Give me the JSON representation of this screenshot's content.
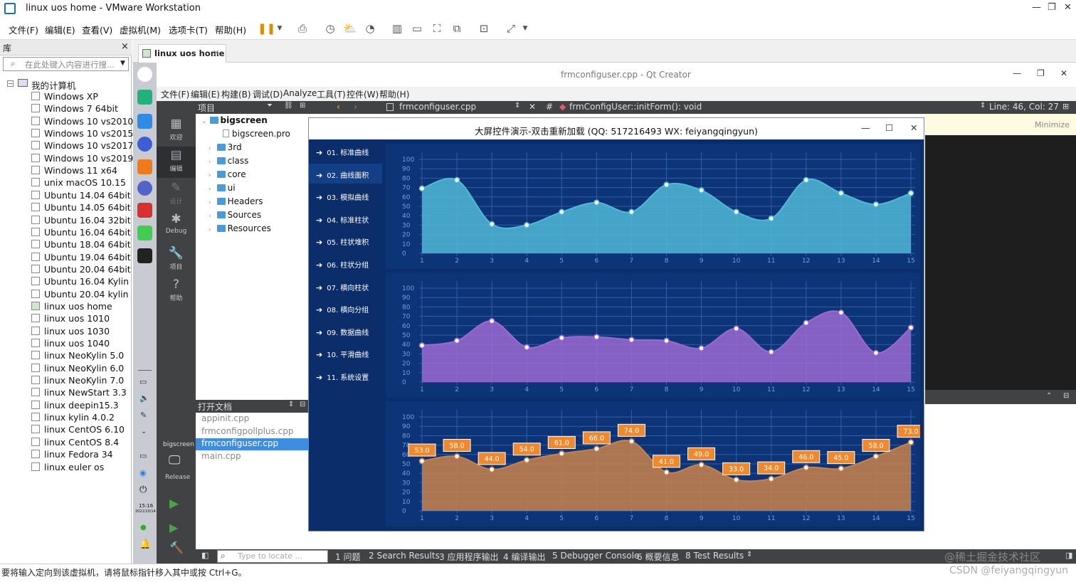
{
  "vmware": {
    "title": "linux uos home - VMware Workstation",
    "menu": [
      "文件(F)",
      "编辑(E)",
      "查看(V)",
      "虚拟机(M)",
      "选项卡(T)",
      "帮助(H)"
    ],
    "library_label": "库",
    "library_close": "×",
    "search_placeholder": "在此处键入内容进行搜...",
    "tree_root": "我的计算机",
    "vms": [
      "Windows XP",
      "Windows 7 64bit",
      "Windows 10 vs2010",
      "Windows 10 vs2015",
      "Windows 10 vs2017",
      "Windows 10 vs2019",
      "Windows 11 x64",
      "unix macOS 10.15",
      "Ubuntu 14.04 64bit",
      "Ubuntu 14.05 64bit",
      "Ubuntu 16.04 32bit",
      "Ubuntu 16.04 64bit",
      "Ubuntu 18.04 64bit",
      "Ubuntu 19.04 64bit",
      "Ubuntu 20.04 64bit",
      "Ubuntu 16.04 Kylin",
      "Ubuntu 20.04 kylin",
      "linux uos home",
      "linux uos 1010",
      "linux uos 1030",
      "linux uos 1040",
      "linux NeoKylin 5.0",
      "linux NeoKylin 6.0",
      "linux NeoKylin 7.0",
      "linux NewStart 3.3",
      "linux deepin15.3",
      "linux kylin 4.0.2",
      "linux CentOS 6.10",
      "linux CentOS 8.4",
      "linux Fedora 34",
      "linux euler os"
    ],
    "active_vm": "linux uos home",
    "tab_label": "linux uos home",
    "status_text": "要将输入定向到该虚拟机，请将鼠标指针移入其中或按 Ctrl+G。",
    "dock_clock": "15:16",
    "dock_date": "2021/10/14"
  },
  "qt": {
    "title": "frmconfiguser.cpp - Qt Creator",
    "menu": [
      "文件(F)",
      "编辑(E)",
      "构建(B)",
      "调试(D)",
      "Analyze",
      "工具(T)",
      "控件(W)",
      "帮助(H)"
    ],
    "modes": [
      {
        "label": "欢迎",
        "icon": "grid-icon"
      },
      {
        "label": "编辑",
        "icon": "edit-icon"
      },
      {
        "label": "设计",
        "icon": "pen-icon"
      },
      {
        "label": "Debug",
        "icon": "bug-icon"
      },
      {
        "label": "项目",
        "icon": "wrench-icon"
      },
      {
        "label": "帮助",
        "icon": "help-icon"
      }
    ],
    "kit_label": "bigscreen",
    "build_label": "Release",
    "project_header": "项目",
    "project_root": "bigscreen",
    "project_file": "bigscreen.pro",
    "project_folders": [
      "3rd",
      "class",
      "core",
      "ui",
      "Headers",
      "Sources",
      "Resources"
    ],
    "open_docs_header": "打开文档",
    "open_docs": [
      "appinit.cpp",
      "frmconfigpollplus.cpp",
      "frmconfiguser.cpp",
      "main.cpp"
    ],
    "active_doc": "frmconfiguser.cpp",
    "editor_file": "frmconfiguser.cpp",
    "editor_symbol": "frmConfigUser::initForm(): void",
    "editor_hash": "#",
    "line_col": "Line: 46, Col: 27",
    "minimize_hint": "Minimize",
    "locate_placeholder": "Type to locate ...",
    "bottom_tabs": [
      "1 问题",
      "2 Search Results",
      "3 应用程序输出",
      "4 编译输出",
      "5 Debugger Console",
      "6 概要信息",
      "8 Test Results"
    ],
    "watermark": "@稀土掘金技术社区",
    "watermark2": "CSDN @feiyangqingyun"
  },
  "dialog": {
    "title": "大屏控件演示-双击重新加载 (QQ: 517216493 WX: feiyangqingyun)",
    "nav": [
      "01. 标准曲线",
      "02. 曲线面积",
      "03. 模拟曲线",
      "04. 标准柱状",
      "05. 柱状堆积",
      "06. 柱状分组",
      "07. 横向柱状",
      "08. 横向分组",
      "09. 数据曲线",
      "10. 平滑曲线",
      "11. 系统设置"
    ],
    "selected_nav": 1
  },
  "chart_data": [
    {
      "type": "area",
      "x": [
        1,
        2,
        3,
        4,
        5,
        6,
        7,
        8,
        9,
        10,
        11,
        12,
        13,
        14,
        15
      ],
      "values": [
        69,
        78,
        31,
        30,
        44,
        54,
        44,
        73,
        67,
        44,
        37,
        78,
        64,
        52,
        64
      ],
      "ylim": [
        0,
        100
      ],
      "yticks": [
        0,
        10,
        20,
        30,
        40,
        50,
        60,
        70,
        80,
        90,
        100
      ],
      "color": "#4fb9d6",
      "grid": true,
      "title": "",
      "xlabel": "",
      "ylabel": ""
    },
    {
      "type": "area",
      "x": [
        1,
        2,
        3,
        4,
        5,
        6,
        7,
        8,
        9,
        10,
        11,
        12,
        13,
        14,
        15
      ],
      "values": [
        39,
        44,
        65,
        37,
        47,
        48,
        45,
        44,
        36,
        57,
        32,
        63,
        74,
        31,
        58
      ],
      "ylim": [
        0,
        100
      ],
      "yticks": [
        0,
        10,
        20,
        30,
        40,
        50,
        60,
        70,
        80,
        90,
        100
      ],
      "color": "#9b6ad1",
      "grid": true,
      "title": "",
      "xlabel": "",
      "ylabel": ""
    },
    {
      "type": "area",
      "x": [
        1,
        2,
        3,
        4,
        5,
        6,
        7,
        8,
        9,
        10,
        11,
        12,
        13,
        14,
        15
      ],
      "values": [
        53.0,
        58.0,
        44.0,
        54.0,
        61.0,
        66.0,
        74.0,
        41.0,
        49.0,
        33.0,
        34.0,
        46.0,
        45.0,
        58.0,
        73.0
      ],
      "labels": [
        "53.0",
        "58.0",
        "44.0",
        "54.0",
        "61.0",
        "66.0",
        "74.0",
        "41.0",
        "49.0",
        "33.0",
        "34.0",
        "46.0",
        "45.0",
        "58.0",
        "73.0"
      ],
      "ylim": [
        0,
        100
      ],
      "yticks": [
        0,
        10,
        20,
        30,
        40,
        50,
        60,
        70,
        80,
        90,
        100
      ],
      "color": "#c7824a",
      "label_color": "#f0892e",
      "grid": true,
      "title": "",
      "xlabel": "",
      "ylabel": ""
    }
  ]
}
